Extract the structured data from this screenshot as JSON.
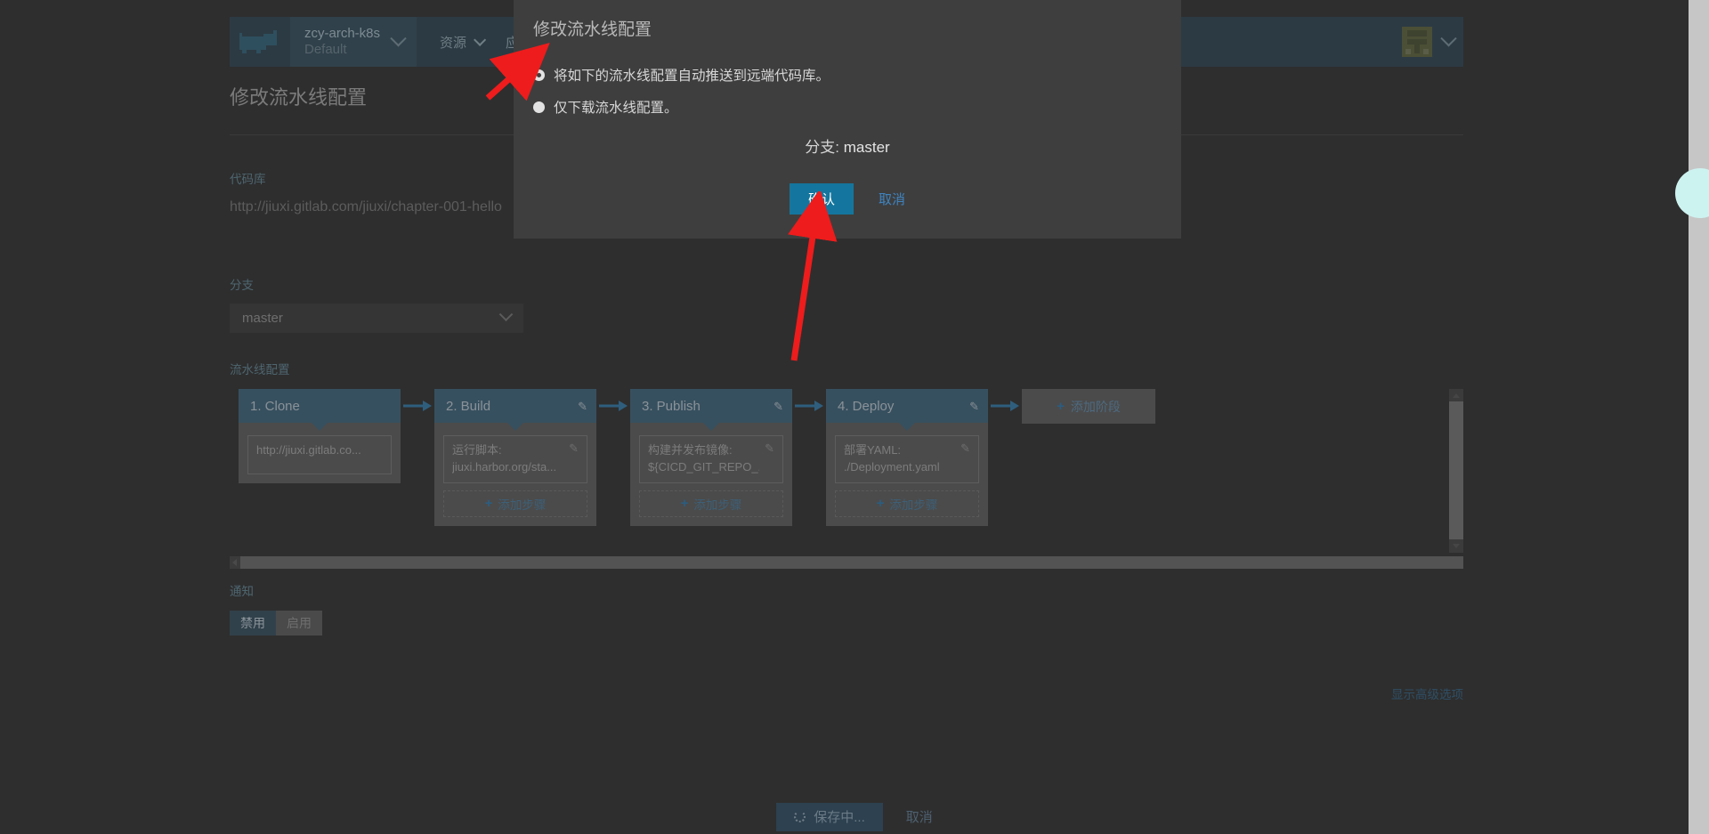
{
  "topbar": {
    "logo_icon": "rancher-cow-logo",
    "cluster": {
      "name": "zcy-arch-k8s",
      "namespace": "Default"
    },
    "nav": [
      {
        "label": "资源",
        "has_chevron": true
      },
      {
        "label": "应用商店",
        "has_chevron": false
      }
    ],
    "avatar_icon": "user-avatar",
    "avatar_chevron_icon": "chevron-down-icon"
  },
  "page": {
    "title": "修改流水线配置",
    "repo_label": "代码库",
    "repo_url": "http://jiuxi.gitlab.com/jiuxi/chapter-001-hello",
    "branch_label": "分支",
    "branch_value": "master",
    "pipeline_label": "流水线配置",
    "add_stage_label": "添加阶段",
    "add_step_label": "添加步骤",
    "notify_label": "通知",
    "toggle": {
      "disabled": "禁用",
      "enabled": "启用",
      "selected": "禁用"
    },
    "advanced_link": "显示高级选项"
  },
  "stages": [
    {
      "index": "1.",
      "name": "Clone",
      "editable": false,
      "steps": [
        {
          "line1": "http://jiuxi.gitlab.co...",
          "line2": "",
          "editable": false
        }
      ],
      "has_add_step": false
    },
    {
      "index": "2.",
      "name": "Build",
      "editable": true,
      "steps": [
        {
          "line1": "运行脚本:",
          "line2": "jiuxi.harbor.org/sta...",
          "editable": true
        }
      ],
      "has_add_step": true
    },
    {
      "index": "3.",
      "name": "Publish",
      "editable": true,
      "steps": [
        {
          "line1": "构建并发布镜像:",
          "line2": "${CICD_GIT_REPO_...",
          "editable": true
        }
      ],
      "has_add_step": true
    },
    {
      "index": "4.",
      "name": "Deploy",
      "editable": true,
      "steps": [
        {
          "line1": "部署YAML:",
          "line2": "./Deployment.yaml",
          "editable": true
        }
      ],
      "has_add_step": true
    }
  ],
  "footer": {
    "save_label": "保存中...",
    "cancel_label": "取消",
    "spinner_icon": "loading-spinner-icon"
  },
  "modal": {
    "title": "修改流水线配置",
    "options": [
      {
        "label": "将如下的流水线配置自动推送到远端代码库。",
        "selected": true
      },
      {
        "label": "仅下载流水线配置。",
        "selected": false
      }
    ],
    "branch_prefix": "分支:",
    "branch_value": "master",
    "confirm_label": "确认",
    "cancel_label": "取消"
  },
  "colors": {
    "accent_blue": "#14769e",
    "link_blue": "#3f84c0",
    "nav_bg": "#2c3a43",
    "stage_head": "#37505f",
    "page_bg": "#2e2e2e",
    "modal_bg": "#3e3e3e",
    "annotation_red": "#ee1c1c"
  }
}
